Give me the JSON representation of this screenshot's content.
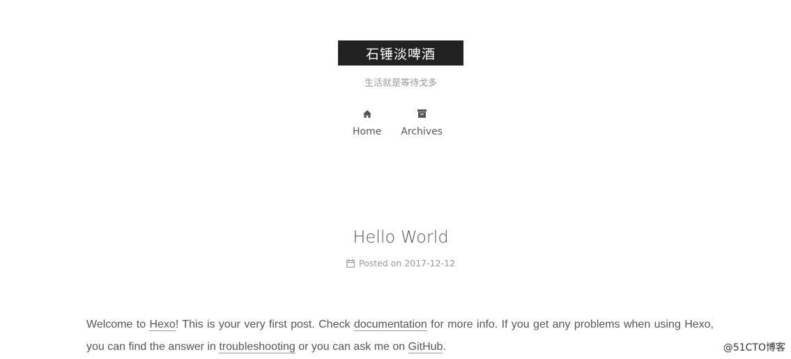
{
  "site": {
    "title": "石锤淡啤酒",
    "subtitle": "生活就是等待戈多"
  },
  "menu": [
    {
      "label": "Home",
      "icon": "home-icon"
    },
    {
      "label": "Archives",
      "icon": "archive-icon"
    }
  ],
  "post": {
    "title": "Hello World",
    "meta_prefix": "Posted on",
    "date": "2017-12-12",
    "body": {
      "t1": "Welcome to ",
      "link_hexo": "Hexo",
      "t2": "! This is your very first post. Check ",
      "link_docs": "documentation",
      "t3": " for more info. If you get any problems when using Hexo, you can find the answer in ",
      "link_troubleshooting": "troubleshooting",
      "t4": " or you can ask me on ",
      "link_github": "GitHub",
      "t5": "."
    }
  },
  "watermark": "@51CTO博客"
}
